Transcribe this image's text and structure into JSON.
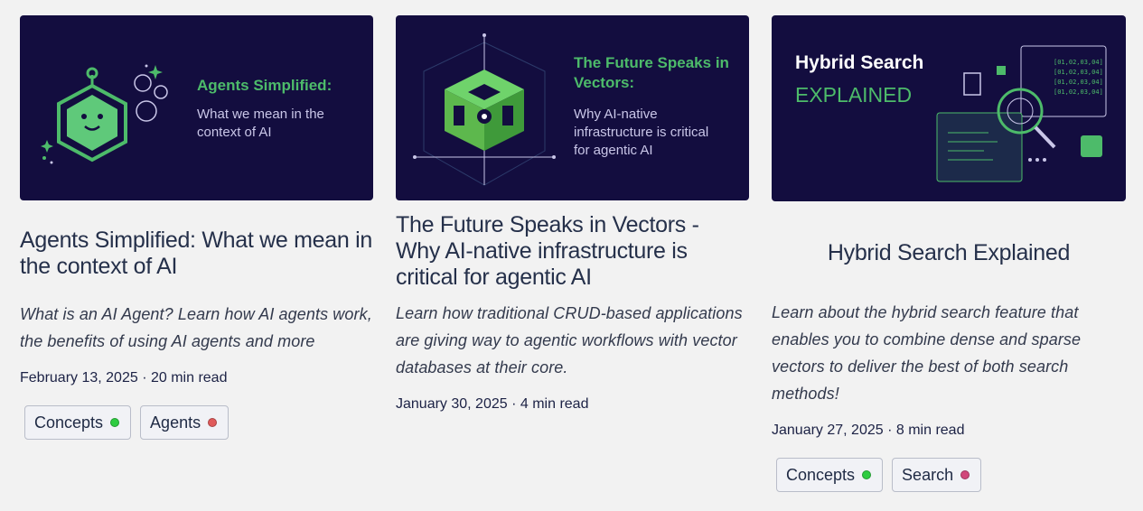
{
  "colors": {
    "thumb_bg": "#130d3f",
    "brand_green": "#4dbb6a",
    "concepts_dot": "#2ecc40",
    "agents_dot": "#e05a5a",
    "search_dot": "#d1477a"
  },
  "cards": [
    {
      "thumb": {
        "headline": "Agents Simplified:",
        "sub": "What we mean in the context of AI"
      },
      "title": "Agents Simplified: What we mean in the context of AI",
      "description": "What is an AI Agent? Learn how AI agents work, the benefits of using AI agents and more",
      "date": "February 13, 2025",
      "read_time": "20 min read",
      "meta": "February 13, 2025 · 20 min read",
      "tags": [
        {
          "label": "Concepts",
          "dot_icon": "green-dot-icon"
        },
        {
          "label": "Agents",
          "dot_icon": "red-dot-icon"
        }
      ]
    },
    {
      "thumb": {
        "headline": "The Future Speaks in Vectors:",
        "sub": "Why AI-native infrastructure is critical for agentic AI"
      },
      "title": "The Future Speaks in Vectors - Why AI-native infrastructure is critical for agentic AI",
      "description": "Learn how traditional CRUD-based applications are giving way to agentic workflows with vector databases at their core.",
      "date": "January 30, 2025",
      "read_time": "4 min read",
      "meta": "January 30, 2025 · 4 min read",
      "tags": []
    },
    {
      "thumb": {
        "headline": "Hybrid Search",
        "sub": "EXPLAINED",
        "code_lines": [
          "[01,02,03,04]",
          "[01,02,03,04]",
          "[01,02,03,04]",
          "[01,02,03,04]"
        ]
      },
      "title": "Hybrid Search Explained",
      "description": "Learn about the hybrid search feature that enables you to combine dense and sparse vectors to deliver the best of both search methods!",
      "date": "January 27, 2025",
      "read_time": "8 min read",
      "meta": "January 27, 2025 · 8 min read",
      "tags": [
        {
          "label": "Concepts",
          "dot_icon": "green-dot-icon"
        },
        {
          "label": "Search",
          "dot_icon": "pink-dot-icon"
        }
      ]
    }
  ]
}
